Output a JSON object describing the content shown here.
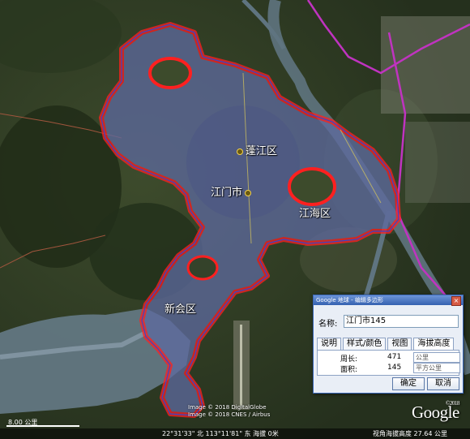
{
  "places": {
    "pengjiang": "蓬江区",
    "jiangmen": "江门市",
    "jianghai": "江海区",
    "xinhui": "新会区"
  },
  "dialog": {
    "title": "Google 地球 - 编辑多边形",
    "close": "×",
    "name_label": "名称:",
    "name_value": "江门市145",
    "tabs": [
      "说明",
      "样式/颜色",
      "视图",
      "海拔高度"
    ],
    "perimeter_label": "周长:",
    "perimeter_value": "471",
    "perimeter_unit": "公里",
    "area_label": "面积:",
    "area_value": "145",
    "area_unit": "平方公里",
    "ok": "确定",
    "cancel": "取消"
  },
  "map": {
    "copyright_1": "Image © 2018 DigitalGlobe",
    "copyright_2": "Image © 2018 CNES / Airbus",
    "google_logo": "Google",
    "logo_year": "©2018",
    "scale_label": "8.00 公里",
    "status_coords": "22°31'33\" 北  113°11'81\" 东  海拔 0米",
    "status_eye": "视角海拔高度  27.64 公里"
  }
}
